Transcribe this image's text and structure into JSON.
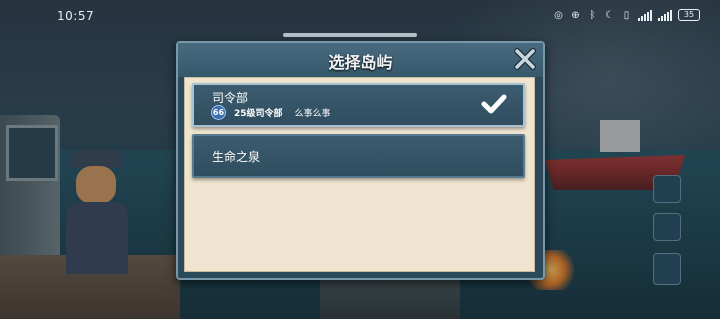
{
  "status_bar": {
    "time": "10:57",
    "battery": "35",
    "icons": [
      "nfc-icon",
      "hotspot-icon",
      "bluetooth-icon",
      "moon-icon",
      "vibrate-icon",
      "signal-icon",
      "signal-icon"
    ]
  },
  "dialog": {
    "title": "选择岛屿",
    "islands": [
      {
        "name": "司令部",
        "level": "66",
        "hq_label": "25级司令部",
        "extra": "么事么事",
        "selected": true
      },
      {
        "name": "生命之泉",
        "selected": false
      }
    ]
  },
  "colors": {
    "dialog_header": "#4a6b7f",
    "panel": "#eee4cf",
    "island_row": "#3c5c6f",
    "check": "#ffffff"
  }
}
